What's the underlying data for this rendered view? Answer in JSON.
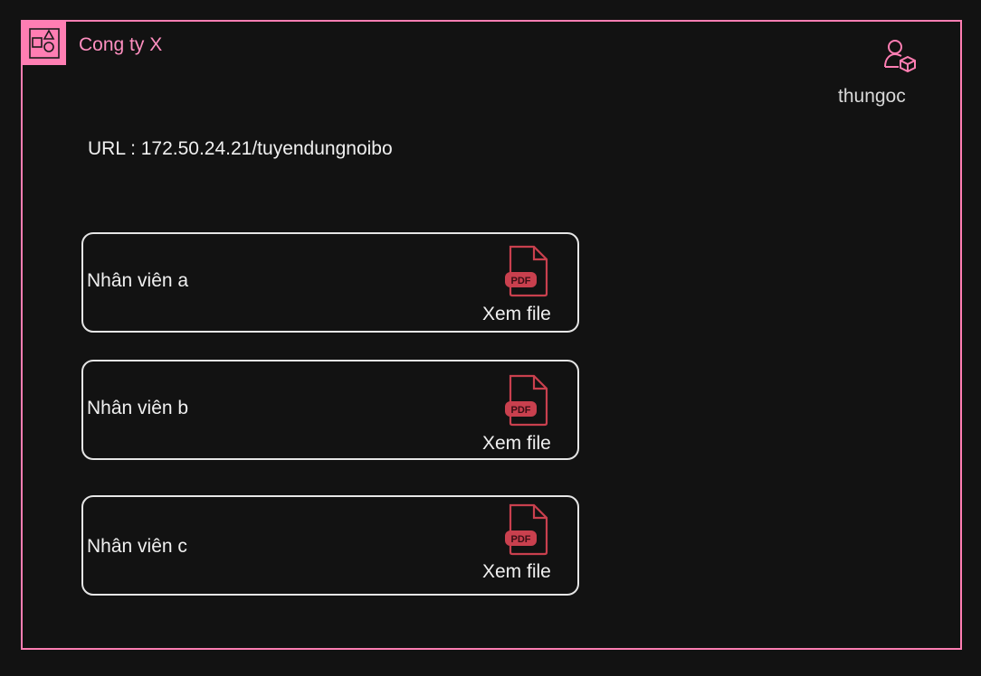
{
  "header": {
    "brand": "Cong ty X",
    "username": "thungoc"
  },
  "url_line": "URL : 172.50.24.21/tuyendungnoibo",
  "employees": [
    {
      "name": "Nhân viên a",
      "file_badge": "PDF",
      "action": "Xem file"
    },
    {
      "name": "Nhân viên b",
      "file_badge": "PDF",
      "action": "Xem file"
    },
    {
      "name": "Nhân viên c",
      "file_badge": "PDF",
      "action": "Xem file"
    }
  ],
  "colors": {
    "background": "#121212",
    "accent": "#ff7eb3",
    "pdf": "#c9404e",
    "text": "#f0f0f0"
  },
  "icons": {
    "logo": "shapes-icon",
    "user": "user-cube-icon",
    "file": "pdf-file-icon"
  }
}
